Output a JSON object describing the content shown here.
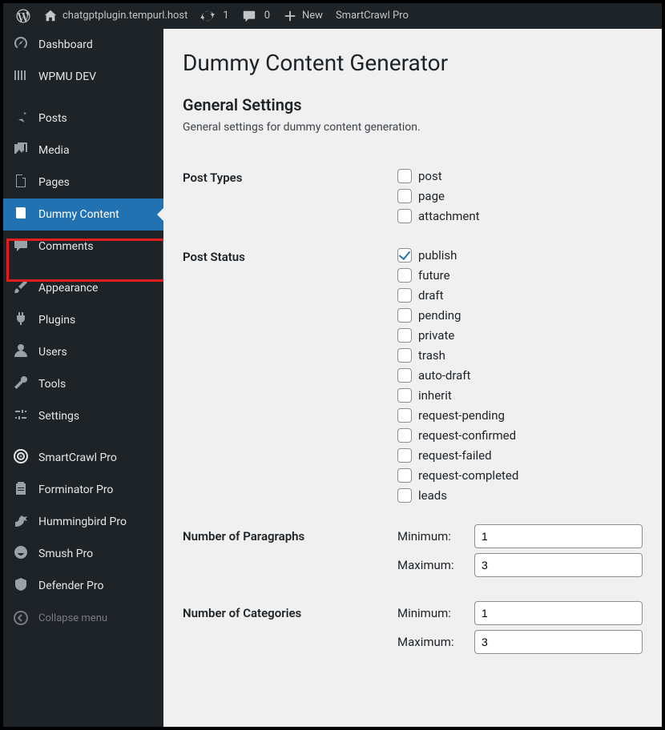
{
  "adminbar": {
    "site_name": "chatgptplugin.tempurl.host",
    "updates_count": "1",
    "comments_count": "0",
    "new_label": "New",
    "smartcrawl_label": "SmartCrawl Pro"
  },
  "sidebar": {
    "items": [
      {
        "id": "dashboard",
        "label": "Dashboard",
        "icon": "dashboard"
      },
      {
        "id": "wpmudev",
        "label": "WPMU DEV",
        "icon": "wpmudev"
      },
      {
        "id": "sep1",
        "separator": true
      },
      {
        "id": "posts",
        "label": "Posts",
        "icon": "pin"
      },
      {
        "id": "media",
        "label": "Media",
        "icon": "media"
      },
      {
        "id": "pages",
        "label": "Pages",
        "icon": "pages"
      },
      {
        "id": "dummy",
        "label": "Dummy Content",
        "icon": "book",
        "active": true
      },
      {
        "id": "comments",
        "label": "Comments",
        "icon": "comment"
      },
      {
        "id": "sep2",
        "separator": true
      },
      {
        "id": "appearance",
        "label": "Appearance",
        "icon": "brush"
      },
      {
        "id": "plugins",
        "label": "Plugins",
        "icon": "plug"
      },
      {
        "id": "users",
        "label": "Users",
        "icon": "user"
      },
      {
        "id": "tools",
        "label": "Tools",
        "icon": "wrench"
      },
      {
        "id": "settings",
        "label": "Settings",
        "icon": "sliders"
      },
      {
        "id": "sep3",
        "separator": true
      },
      {
        "id": "smartcrawl",
        "label": "SmartCrawl Pro",
        "icon": "target"
      },
      {
        "id": "forminator",
        "label": "Forminator Pro",
        "icon": "clipboard"
      },
      {
        "id": "hummingbird",
        "label": "Hummingbird Pro",
        "icon": "bird"
      },
      {
        "id": "smush",
        "label": "Smush Pro",
        "icon": "smush"
      },
      {
        "id": "defender",
        "label": "Defender Pro",
        "icon": "shield"
      }
    ],
    "collapse_label": "Collapse menu"
  },
  "page": {
    "title": "Dummy Content Generator",
    "section_title": "General Settings",
    "section_desc": "General settings for dummy content generation."
  },
  "fields": {
    "post_types": {
      "label": "Post Types",
      "options": [
        {
          "value": "post",
          "checked": false
        },
        {
          "value": "page",
          "checked": false
        },
        {
          "value": "attachment",
          "checked": false
        }
      ]
    },
    "post_status": {
      "label": "Post Status",
      "options": [
        {
          "value": "publish",
          "checked": true
        },
        {
          "value": "future",
          "checked": false
        },
        {
          "value": "draft",
          "checked": false
        },
        {
          "value": "pending",
          "checked": false
        },
        {
          "value": "private",
          "checked": false
        },
        {
          "value": "trash",
          "checked": false
        },
        {
          "value": "auto-draft",
          "checked": false
        },
        {
          "value": "inherit",
          "checked": false
        },
        {
          "value": "request-pending",
          "checked": false
        },
        {
          "value": "request-confirmed",
          "checked": false
        },
        {
          "value": "request-failed",
          "checked": false
        },
        {
          "value": "request-completed",
          "checked": false
        },
        {
          "value": "leads",
          "checked": false
        }
      ]
    },
    "num_paragraphs": {
      "label": "Number of Paragraphs",
      "min_label": "Minimum:",
      "max_label": "Maximum:",
      "min": "1",
      "max": "3"
    },
    "num_categories": {
      "label": "Number of Categories",
      "min_label": "Minimum:",
      "max_label": "Maximum:",
      "min": "1",
      "max": "3"
    }
  }
}
